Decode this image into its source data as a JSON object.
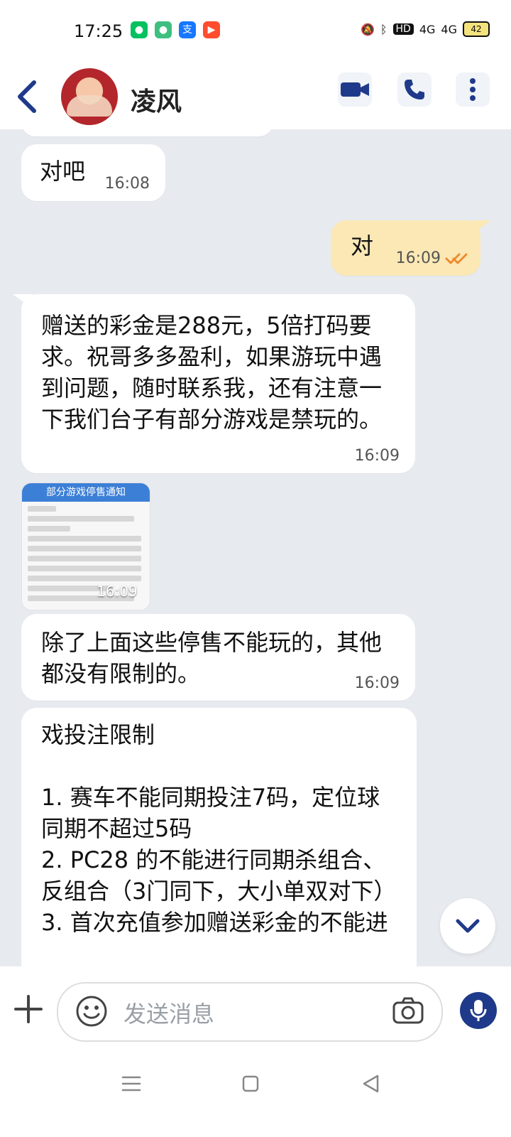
{
  "status": {
    "time": "17:25",
    "battery": "42",
    "network_left": "4G",
    "network_right": "4G"
  },
  "header": {
    "contact_name": "凌风"
  },
  "messages": [
    {
      "sender": "them",
      "text": "对吧",
      "time": "16:08"
    },
    {
      "sender": "me",
      "text": "对",
      "time": "16:09",
      "status": "read"
    },
    {
      "sender": "them",
      "text": "赠送的彩金是288元，5倍打码要求。祝哥多多盈利，如果游玩中遇到问题，随时联系我，还有注意一下我们台子有部分游戏是禁玩的。",
      "time": "16:09"
    },
    {
      "sender": "them",
      "type": "image",
      "image_title": "部分游戏停售通知",
      "time": "16:09"
    },
    {
      "sender": "them",
      "text": "除了上面这些停售不能玩的，其他都没有限制的。",
      "time": "16:09"
    },
    {
      "sender": "them",
      "text": "戏投注限制\n\n1. 赛车不能同期投注7码，定位球同期不超过5码\n2. PC28 的不能进行同期杀组合、反组合（3门同下，大小单双对下）\n3. 首次充值参加赠送彩金的不能进"
    }
  ],
  "composer": {
    "placeholder": "发送消息"
  }
}
